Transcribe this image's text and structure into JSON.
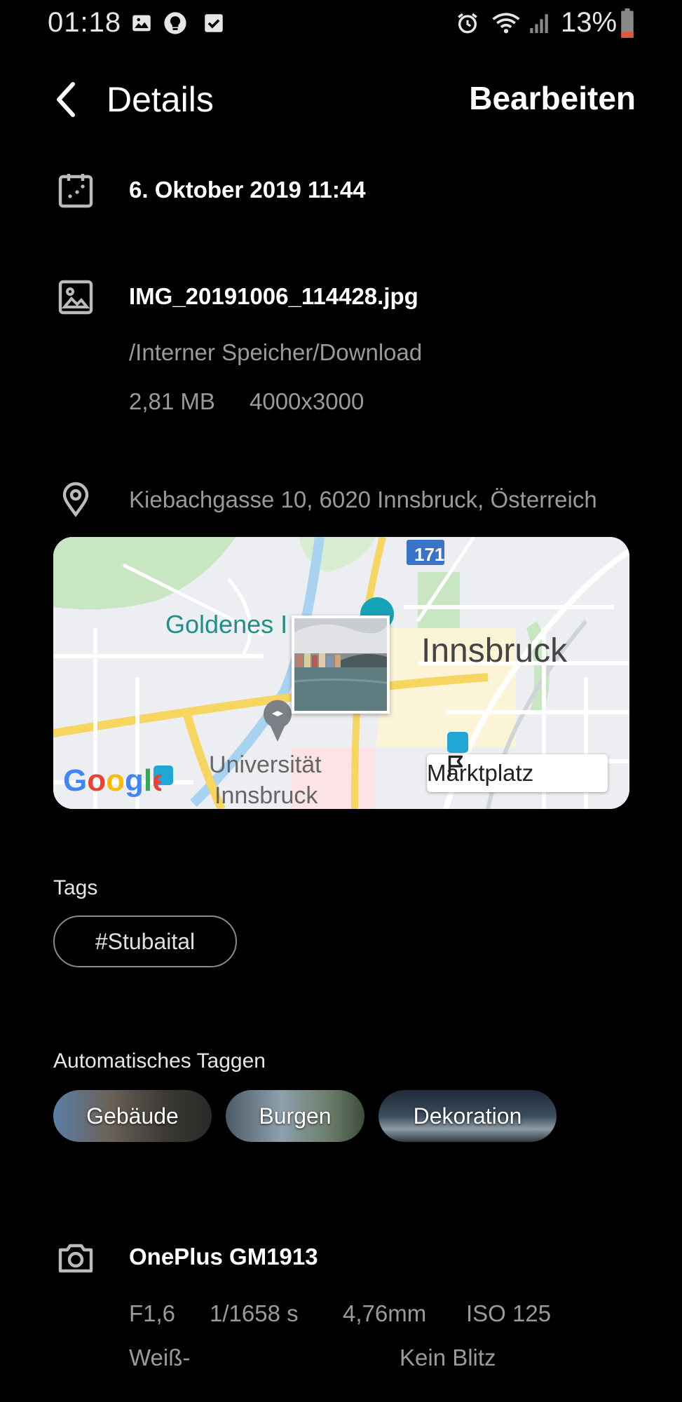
{
  "status_bar": {
    "time": "01:18",
    "battery": "13%",
    "left_icons": [
      "image-icon",
      "bulb-icon",
      "check-box-icon"
    ],
    "right_icons": [
      "alarm-icon",
      "wifi-icon",
      "signal-icon",
      "battery-icon"
    ]
  },
  "header": {
    "title": "Details",
    "edit_label": "Bearbeiten"
  },
  "date": {
    "value": "6. Oktober 2019 11:44"
  },
  "file": {
    "name": "IMG_20191006_114428.jpg",
    "path": "/Interner Speicher/Download",
    "size": "2,81 MB",
    "resolution": "4000x3000"
  },
  "location": {
    "address": "Kiebachgasse 10, 6020 Innsbruck, Österreich",
    "map": {
      "city_label": "Innsbruck",
      "poi_label": "Goldenes I",
      "university_label_line1": "Universität",
      "university_label_line2": "Innsbruck",
      "route_badge": "171",
      "place_button": "Marktplatz",
      "attribution": "Google"
    }
  },
  "tags": {
    "label": "Tags",
    "items": [
      "#Stubaital"
    ]
  },
  "auto_tags": {
    "label": "Automatisches Taggen",
    "items": [
      "Gebäude",
      "Burgen",
      "Dekoration"
    ]
  },
  "camera": {
    "model": "OnePlus GM1913",
    "aperture": "F1,6",
    "shutter": "1/1658 s",
    "focal_length": "4,76mm",
    "iso": "ISO 125",
    "white_balance": "Weiß-",
    "flash": "Kein Blitz"
  },
  "colors": {
    "background": "#000000",
    "primary_text": "#ffffff",
    "secondary_text": "#9a9a9a",
    "battery_low": "#e5573d"
  }
}
